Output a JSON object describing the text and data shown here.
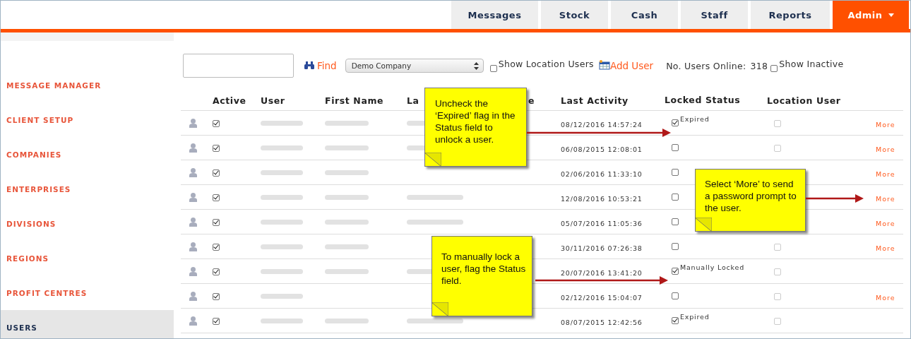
{
  "nav": {
    "tabs": [
      {
        "label": "Messages",
        "selected": false
      },
      {
        "label": "Stock",
        "selected": false
      },
      {
        "label": "Cash",
        "selected": false
      },
      {
        "label": "Staff",
        "selected": false
      },
      {
        "label": "Reports",
        "selected": false
      },
      {
        "label": "Admin",
        "selected": true
      }
    ]
  },
  "sidebar": {
    "items": [
      {
        "label": "MESSAGE MANAGER",
        "selected": false
      },
      {
        "label": "CLIENT SETUP",
        "selected": false
      },
      {
        "label": "COMPANIES",
        "selected": false
      },
      {
        "label": "ENTERPRISES",
        "selected": false
      },
      {
        "label": "DIVISIONS",
        "selected": false
      },
      {
        "label": "REGIONS",
        "selected": false
      },
      {
        "label": "PROFIT CENTRES",
        "selected": false
      },
      {
        "label": "USERS",
        "selected": true
      }
    ]
  },
  "toolbar": {
    "find": "Find",
    "company": "Demo Company",
    "show_location_users": {
      "label": "Show Location Users",
      "checked": false
    },
    "add_user": "Add User",
    "users_online_label": "No. Users Online:",
    "users_online": "318",
    "show_inactive": {
      "label": "Show Inactive",
      "checked": false
    }
  },
  "table": {
    "columns": [
      "Active",
      "User",
      "First Name",
      "La",
      "e",
      "Last Activity",
      "Locked Status",
      "Location User"
    ],
    "rows": [
      {
        "active": true,
        "redacted": {
          "user": true,
          "first_name": true,
          "last_name": true
        },
        "last_activity": "08/12/2016 14:57:24",
        "locked": true,
        "status": "Expired",
        "location_user": false,
        "more": "More"
      },
      {
        "active": true,
        "redacted": {
          "user": true,
          "first_name": true,
          "last_name": true
        },
        "last_activity": "06/08/2015 12:08:01",
        "locked": false,
        "location_user": false,
        "more": "More"
      },
      {
        "active": true,
        "redacted": {
          "user": true,
          "first_name": true,
          "last_name": false
        },
        "last_activity": "02/06/2016 11:33:10",
        "locked": false,
        "more": "More"
      },
      {
        "active": true,
        "redacted": {
          "user": true,
          "first_name": true,
          "last_name": true
        },
        "last_activity": "12/08/2016 10:53:21",
        "locked": false,
        "more": "More"
      },
      {
        "active": true,
        "redacted": {
          "user": true,
          "first_name": true,
          "last_name": true
        },
        "last_activity": "05/07/2016 11:05:36",
        "locked": false,
        "more": "More"
      },
      {
        "active": true,
        "redacted": {
          "user": true,
          "first_name": true,
          "last_name": false
        },
        "last_activity": "30/11/2016 07:26:38",
        "locked": false,
        "location_user": false,
        "more": "More"
      },
      {
        "active": true,
        "redacted": {
          "user": true,
          "first_name": true,
          "last_name": true
        },
        "last_activity": "20/07/2016 13:41:20",
        "locked": true,
        "status": "Manually Locked",
        "location_user": false
      },
      {
        "active": true,
        "redacted": {
          "user": true,
          "first_name": false,
          "last_name": false
        },
        "last_activity": "02/12/2016 15:04:07",
        "locked": false,
        "location_user": false,
        "more": "More"
      },
      {
        "active": true,
        "redacted": {
          "user": true,
          "first_name": true,
          "last_name": true
        },
        "last_activity": "08/07/2015 12:42:56",
        "locked": true,
        "status": "Expired",
        "location_user": false
      }
    ]
  },
  "callouts": [
    {
      "text": "Uncheck the ‘Expired’ flag in the Status field to unlock a user."
    },
    {
      "text": "Select ‘More’ to send a password prompt to the user."
    },
    {
      "text": "To manually lock a user, flag the Status field."
    }
  ]
}
